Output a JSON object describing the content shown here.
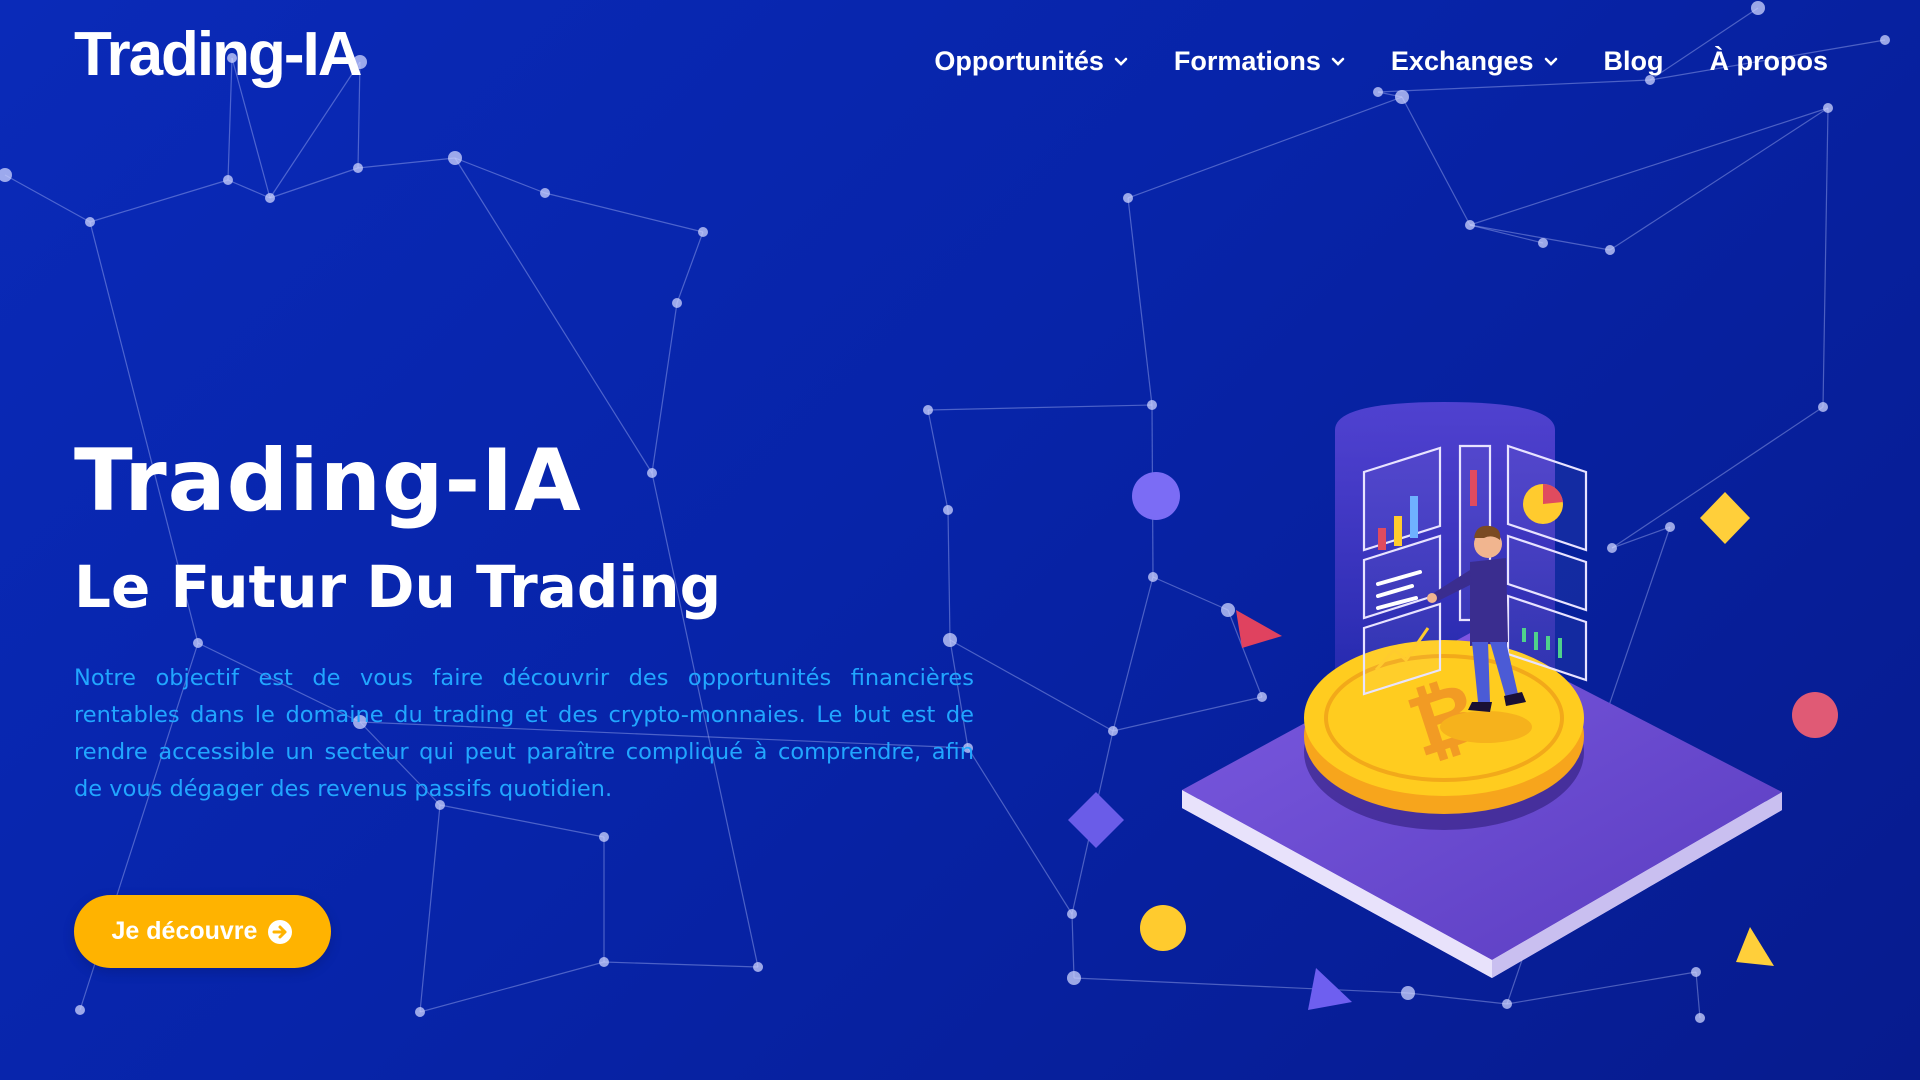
{
  "header": {
    "logo": "Trading-IA",
    "nav": [
      {
        "label": "Opportunités",
        "dropdown": true
      },
      {
        "label": "Formations",
        "dropdown": true
      },
      {
        "label": "Exchanges",
        "dropdown": true
      },
      {
        "label": "Blog",
        "dropdown": false
      },
      {
        "label": "À propos",
        "dropdown": false
      }
    ]
  },
  "hero": {
    "title": "Trading-IA",
    "subtitle": "Le Futur Du Trading",
    "description": "Notre objectif est de vous faire découvrir des opportunités financières rentables dans le domaine du trading et des crypto-monnaies. Le but est de rendre accessible un secteur qui peut paraître compliqué à comprendre, afin de vous dégager des revenus passifs quotidien.",
    "cta_label": "Je découvre"
  },
  "icons": {
    "nav_dropdown": "chevron-down-icon",
    "cta": "arrow-circle-right-icon",
    "coin": "bitcoin-icon"
  },
  "colors": {
    "background": "#0724a9",
    "accent_text": "#21a6ff",
    "cta": "#ffb300",
    "coin": "#ffcc1f",
    "platform": "#6a46c8"
  }
}
